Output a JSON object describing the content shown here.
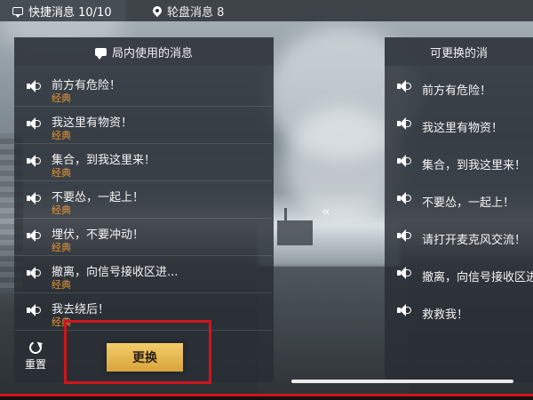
{
  "tabs": [
    {
      "label": "快捷消息 10/10",
      "icon": "message-icon",
      "active": true
    },
    {
      "label": "轮盘消息 8",
      "icon": "location-pin-icon",
      "active": false
    }
  ],
  "left_panel": {
    "title": "局内使用的消息",
    "icon": "message-icon",
    "items": [
      {
        "text": "前方有危险！",
        "tag": "经典"
      },
      {
        "text": "我这里有物资！",
        "tag": "经典"
      },
      {
        "text": "集合，到我这里来！",
        "tag": "经典"
      },
      {
        "text": "不要怂，一起上！",
        "tag": "经典"
      },
      {
        "text": "埋伏，不要冲动！",
        "tag": "经典"
      },
      {
        "text": "撤离，向信号接收区进...",
        "tag": "经典"
      },
      {
        "text": "我去绕后！",
        "tag": "经典"
      }
    ]
  },
  "right_panel": {
    "title": "可更换的消",
    "items": [
      {
        "text": "前方有危险！"
      },
      {
        "text": "我这里有物资！"
      },
      {
        "text": "集合，到我这里来！"
      },
      {
        "text": "不要怂，一起上！"
      },
      {
        "text": "请打开麦克风交流！"
      },
      {
        "text": "撤离，向信号接收区进"
      },
      {
        "text": "救救我！"
      }
    ]
  },
  "actions": {
    "reset_label": "重置",
    "replace_label": "更换"
  },
  "misc": {
    "collapse_chevron": "«"
  },
  "colors": {
    "tag_orange": "#e8952e",
    "button_gold": "#e6b44f",
    "highlight_red": "#d0141c"
  }
}
